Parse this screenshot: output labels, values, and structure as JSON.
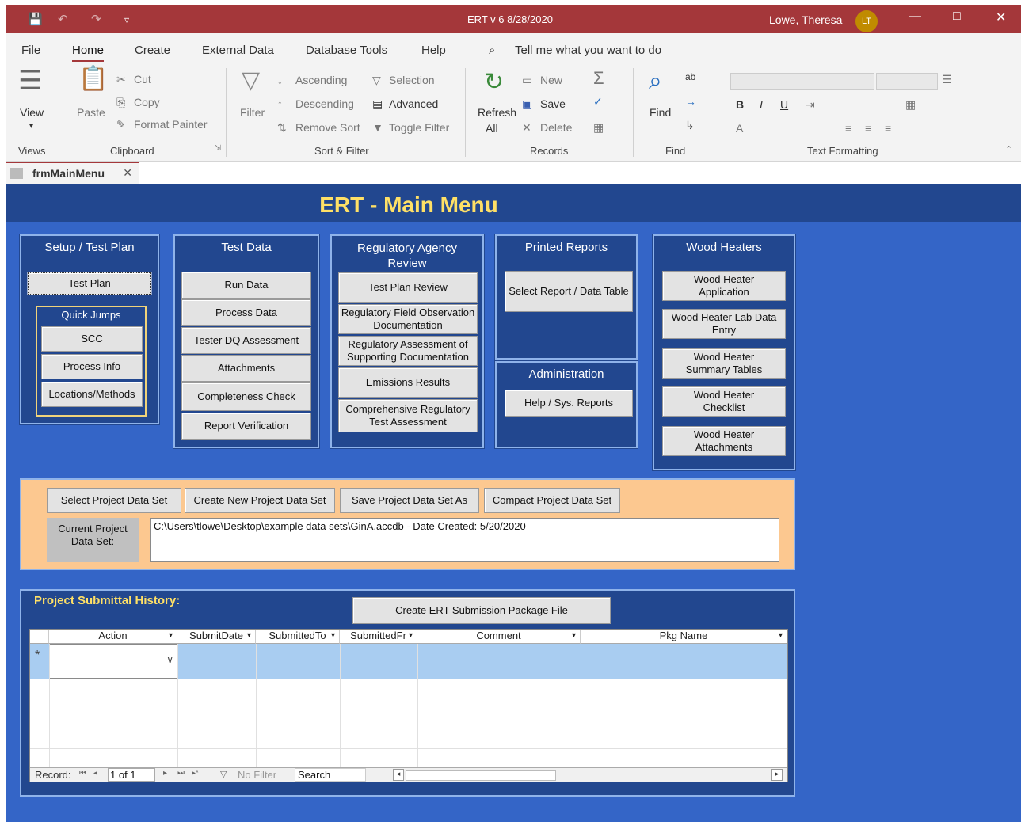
{
  "titlebar": {
    "title": "ERT v 6  8/28/2020",
    "user": "Lowe, Theresa",
    "initials": "LT"
  },
  "menu": [
    "File",
    "Home",
    "Create",
    "External Data",
    "Database Tools",
    "Help"
  ],
  "tell_me": "Tell me what you want to do",
  "ribbon": {
    "view": "View",
    "paste": "Paste",
    "cut": "Cut",
    "copy": "Copy",
    "format_painter": "Format Painter",
    "filter": "Filter",
    "ascending": "Ascending",
    "descending": "Descending",
    "remove_sort": "Remove Sort",
    "selection": "Selection",
    "advanced": "Advanced",
    "toggle_filter": "Toggle Filter",
    "refresh": "Refresh",
    "all": "All",
    "new": "New",
    "save": "Save",
    "delete": "Delete",
    "find": "Find",
    "groups": {
      "views": "Views",
      "clipboard": "Clipboard",
      "sort_filter": "Sort & Filter",
      "records": "Records",
      "find": "Find",
      "text_formatting": "Text Formatting"
    }
  },
  "doc_tab": "frmMainMenu",
  "form": {
    "header": "ERT - Main Menu",
    "setup": {
      "title": "Setup / Test Plan",
      "test_plan": "Test Plan",
      "quick_jumps": "Quick Jumps",
      "scc": "SCC",
      "process_info": "Process Info",
      "locations": "Locations/Methods"
    },
    "test_data": {
      "title": "Test Data",
      "items": [
        "Run Data",
        "Process Data",
        "Tester DQ Assessment",
        "Attachments",
        "Completeness Check",
        "Report Verification"
      ]
    },
    "regulatory": {
      "title": "Regulatory Agency Review",
      "items": [
        "Test Plan Review",
        "Regulatory Field Observation Documentation",
        "Regulatory Assessment of Supporting Documentation",
        "Emissions Results",
        "Comprehensive Regulatory Test Assessment"
      ]
    },
    "printed": {
      "title": "Printed Reports",
      "select": "Select Report / Data Table"
    },
    "admin": {
      "title": "Administration",
      "help": "Help / Sys. Reports"
    },
    "wood": {
      "title": "Wood Heaters",
      "items": [
        "Wood Heater Application",
        "Wood Heater Lab Data Entry",
        "Wood Heater Summary Tables",
        "Wood Heater Checklist",
        "Wood Heater Attachments"
      ]
    },
    "project": {
      "select": "Select Project Data Set",
      "create": "Create New Project Data Set",
      "save_as": "Save Project Data Set As",
      "compact": "Compact Project Data Set",
      "current_label": "Current Project Data Set:",
      "current_value": "C:\\Users\\tlowe\\Desktop\\example data sets\\GinA.accdb - Date Created: 5/20/2020"
    },
    "history": {
      "title": "Project Submittal History:",
      "create_pkg": "Create ERT Submission Package File",
      "columns": [
        "Action",
        "SubmitDate",
        "SubmittedTo",
        "SubmittedFr",
        "Comment",
        "Pkg Name"
      ],
      "new_row_marker": "*",
      "nav": {
        "record_label": "Record:",
        "position": "1 of 1",
        "no_filter": "No Filter",
        "search": "Search"
      }
    }
  }
}
